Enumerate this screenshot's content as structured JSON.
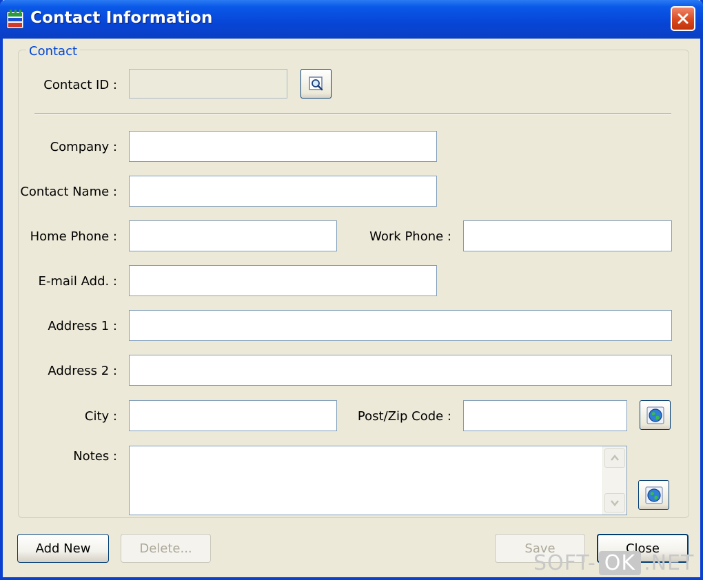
{
  "window": {
    "title": "Contact Information"
  },
  "group": {
    "title": "Contact"
  },
  "fields": {
    "contact_id": {
      "label": "Contact ID :",
      "value": ""
    },
    "company": {
      "label": "Company :",
      "value": ""
    },
    "contact_name": {
      "label": "Contact Name :",
      "value": ""
    },
    "home_phone": {
      "label": "Home Phone :",
      "value": ""
    },
    "work_phone": {
      "label": "Work Phone :",
      "value": ""
    },
    "email": {
      "label": "E-mail Add. :",
      "value": ""
    },
    "address1": {
      "label": "Address 1 :",
      "value": ""
    },
    "address2": {
      "label": "Address 2 :",
      "value": ""
    },
    "city": {
      "label": "City :",
      "value": ""
    },
    "zip": {
      "label": "Post/Zip Code :",
      "value": ""
    },
    "notes": {
      "label": "Notes :",
      "value": ""
    }
  },
  "buttons": {
    "add_new": "Add New",
    "delete": "Delete...",
    "save": "Save",
    "close": "Close"
  },
  "icons": {
    "search": "magnifier-icon",
    "globe": "globe-icon",
    "close": "close-x-icon"
  },
  "watermark": {
    "left": "SOFT-",
    "mid": "OK",
    "right": ".NET"
  }
}
